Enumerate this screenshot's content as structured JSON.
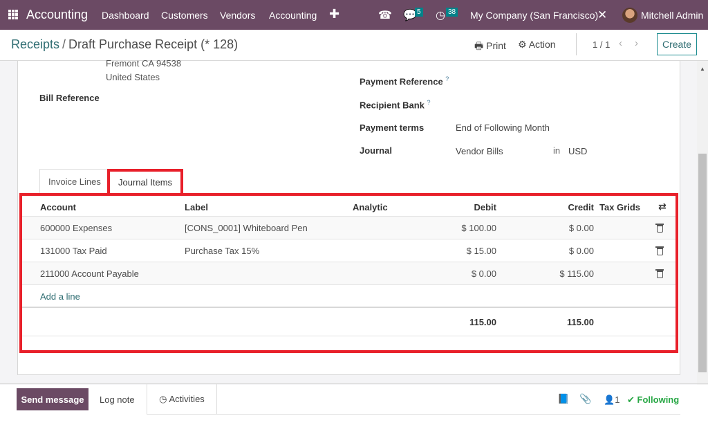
{
  "navbar": {
    "app_name": "Accounting",
    "menu": [
      "Dashboard",
      "Customers",
      "Vendors",
      "Accounting"
    ],
    "messages_count": "5",
    "activities_count": "38",
    "company": "My Company (San Francisco)",
    "user": "Mitchell Admin",
    "brand_color": "#6b4a64"
  },
  "control_panel": {
    "breadcrumb_parent": "Receipts",
    "breadcrumb_separator": "/",
    "breadcrumb_current": "Draft Purchase Receipt (* 128)",
    "print_label": "Print",
    "action_label": "Action",
    "pager": "1 / 1",
    "create_label": "Create"
  },
  "form": {
    "address_line1": "Fremont CA 94538",
    "address_line2": "United States",
    "bill_reference_label": "Bill Reference",
    "payment_reference_label": "Payment Reference",
    "recipient_bank_label": "Recipient Bank",
    "tooltip_mark": "?",
    "payment_terms_label": "Payment terms",
    "payment_terms_value": "End of Following Month",
    "journal_label": "Journal",
    "journal_value": "Vendor Bills",
    "journal_in": "in",
    "currency": "USD"
  },
  "tabs": {
    "invoice_lines": "Invoice Lines",
    "journal_items": "Journal Items",
    "active": "Journal Items"
  },
  "journal_items": {
    "columns": [
      "Account",
      "Label",
      "Analytic",
      "Debit",
      "Credit",
      "Tax Grids"
    ],
    "rows": [
      {
        "account": "600000 Expenses",
        "label": "[CONS_0001] Whiteboard Pen",
        "analytic": "",
        "debit": "$ 100.00",
        "credit": "$ 0.00",
        "tax_grids": ""
      },
      {
        "account": "131000 Tax Paid",
        "label": "Purchase Tax 15%",
        "analytic": "",
        "debit": "$ 15.00",
        "credit": "$ 0.00",
        "tax_grids": ""
      },
      {
        "account": "211000 Account Payable",
        "label": "",
        "analytic": "",
        "debit": "$ 0.00",
        "credit": "$ 115.00",
        "tax_grids": ""
      }
    ],
    "add_line_label": "Add a line",
    "total_debit": "115.00",
    "total_credit": "115.00",
    "highlight_color": "#e8202a"
  },
  "chatter": {
    "send_message": "Send message",
    "log_note": "Log note",
    "activities": "Activities",
    "followers_count": "1",
    "following": "Following"
  }
}
